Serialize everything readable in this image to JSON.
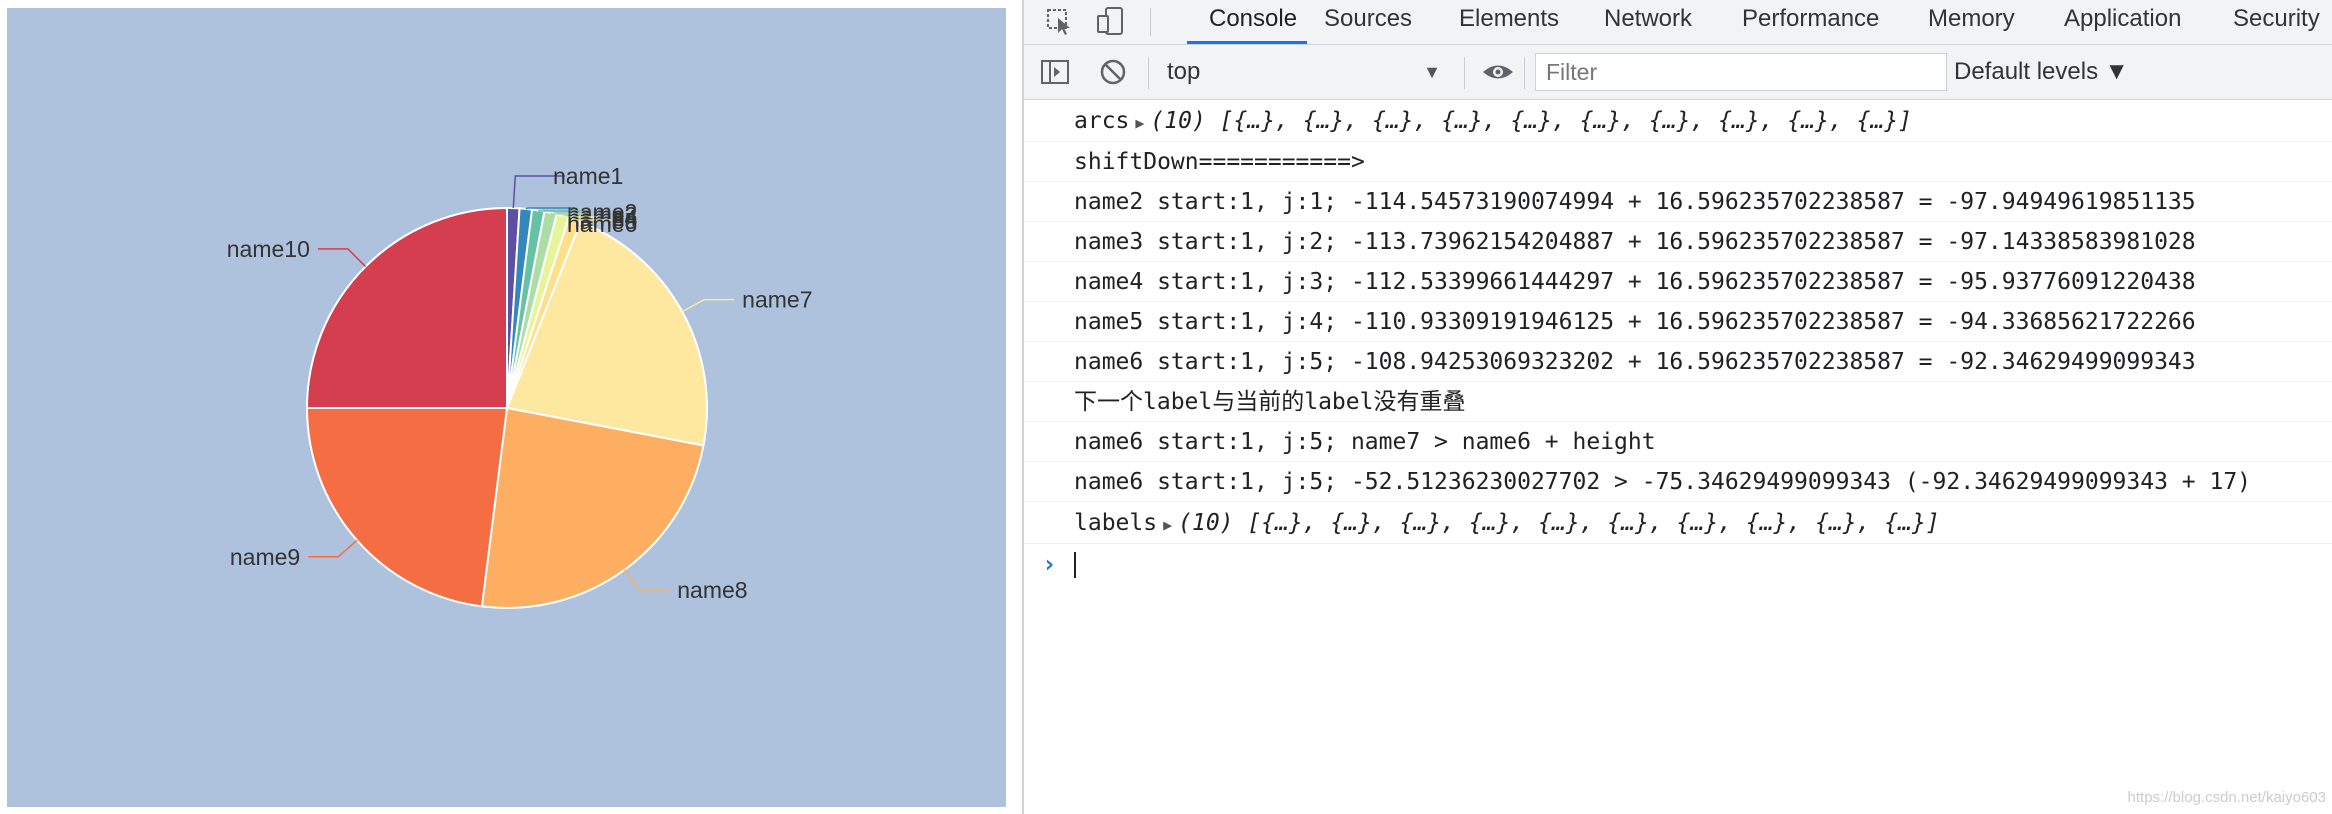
{
  "chart_data": {
    "type": "pie",
    "categories": [
      "name1",
      "name2",
      "name3",
      "name4",
      "name5",
      "name6",
      "name7",
      "name8",
      "name9",
      "name10"
    ],
    "values": [
      1,
      1,
      1,
      1,
      1,
      1,
      22,
      24,
      23,
      25
    ],
    "colors": [
      "#5e4fa2",
      "#3288bd",
      "#66c2a5",
      "#abdda4",
      "#e6f598",
      "#fee08b",
      "#fee8a0",
      "#fdae61",
      "#f46d43",
      "#d53e4f"
    ],
    "labels": [
      "name1",
      "name2",
      "name3",
      "name4",
      "name5",
      "name6",
      "name7",
      "name8",
      "name9",
      "name10"
    ]
  },
  "devtools": {
    "tabs": [
      "Console",
      "Sources",
      "Elements",
      "Network",
      "Performance",
      "Memory",
      "Application",
      "Security"
    ],
    "active_tab": "Console",
    "context": "top",
    "filter_placeholder": "Filter",
    "levels": "Default levels ▼",
    "messages": {
      "arcs_label": "arcs",
      "arcs_value": "(10) [{…}, {…}, {…}, {…}, {…}, {…}, {…}, {…}, {…}, {…}]",
      "m1": "shiftDown===========>",
      "m2": "name2 start:1, j:1; -114.54573190074994 + 16.596235702238587 = -97.94949619851135",
      "m3": "name3 start:1, j:2; -113.73962154204887 + 16.596235702238587 = -97.14338583981028",
      "m4": "name4 start:1, j:3; -112.53399661444297 + 16.596235702238587 = -95.93776091220438",
      "m5": "name5 start:1, j:4; -110.93309191946125 + 16.596235702238587 = -94.33685621722266",
      "m6": "name6 start:1, j:5; -108.94253069323202 + 16.596235702238587 = -92.34629499099343",
      "m7": "下一个label与当前的label没有重叠",
      "m8": "name6 start:1, j:5; name7 > name6 + height",
      "m9": "name6 start:1, j:5; -52.51236230027702 > -75.34629499099343 (-92.34629499099343 + 17)",
      "labels_label": "labels",
      "labels_value": "(10) [{…}, {…}, {…}, {…}, {…}, {…}, {…}, {…}, {…}, {…}]"
    },
    "watermark": "https://blog.csdn.net/kaiyo603"
  }
}
